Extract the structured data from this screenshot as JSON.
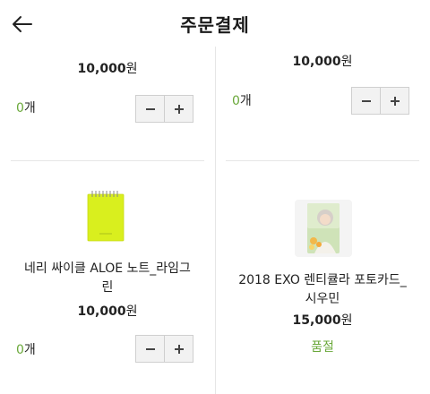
{
  "header": {
    "title": "주문결제"
  },
  "items": [
    {
      "price": "10,000",
      "currency": "원",
      "quantity": "0",
      "quantity_unit": "개"
    },
    {
      "price": "10,000",
      "currency": "원",
      "quantity": "0",
      "quantity_unit": "개"
    },
    {
      "name_line1": "네리 싸이클 ALOE 노트_라임그",
      "name_line2": "린",
      "price": "10,000",
      "currency": "원",
      "quantity": "0",
      "quantity_unit": "개"
    },
    {
      "name_line1": "2018 EXO 렌티큘라 포토카드_",
      "name_line2": "시우민",
      "price": "15,000",
      "currency": "원",
      "status": "품절"
    }
  ],
  "colors": {
    "accent": "#6aa83a",
    "notebook": "#d9ef1e",
    "divider": "#e6e6e6"
  },
  "icons": {
    "back": "arrow-left-icon",
    "minus": "minus-icon",
    "plus": "plus-icon"
  }
}
